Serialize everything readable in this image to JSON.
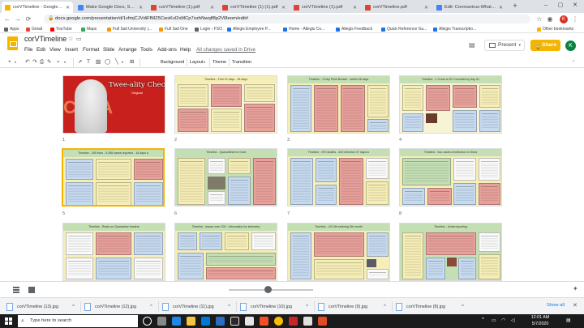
{
  "browser": {
    "tabs": [
      {
        "title": "corVTimeline - Google Sli",
        "active": true,
        "color": "#f4b400"
      },
      {
        "title": "Make Google Docs, Sheets,",
        "active": false,
        "color": "#4285f4"
      },
      {
        "title": "corVTimeline (1).pdf",
        "active": false,
        "color": "#db4437"
      },
      {
        "title": "corVTimeline (1) (1).pdf",
        "active": false,
        "color": "#db4437"
      },
      {
        "title": "corVTimeline (1).pdf",
        "active": false,
        "color": "#db4437"
      },
      {
        "title": "corVTimeline.pdf",
        "active": false,
        "color": "#db4437"
      },
      {
        "title": "Edit: Coronavirus-What do",
        "active": false,
        "color": "#4285f4"
      }
    ],
    "new_tab": "+",
    "window_controls": {
      "minimize": "–",
      "maximize": "▢",
      "close": "✕"
    },
    "url": "docs.google.com/presentation/d/1vfmjCJVdiFfMZ5CwsKvl2xMCp7ozhNwqlf8p2Vl8eom/edit#",
    "profile_initial": "K",
    "bookmarks": [
      {
        "label": "Apps",
        "color": "#5f6368"
      },
      {
        "label": "Gmail",
        "color": "#ea4335"
      },
      {
        "label": "YouTube",
        "color": "#ff0000"
      },
      {
        "label": "Maps",
        "color": "#34a853"
      },
      {
        "label": "Full Sail University |...",
        "color": "#f29900"
      },
      {
        "label": "Full Sail One",
        "color": "#f29900"
      },
      {
        "label": "Login ‹ FSO",
        "color": "#5f6368"
      },
      {
        "label": "Allegis Employee P...",
        "color": "#1a73e8"
      },
      {
        "label": "Home - Allegis Co...",
        "color": "#1a73e8"
      },
      {
        "label": "Allegis Feedback",
        "color": "#1a73e8"
      },
      {
        "label": "Quick Reference Gu...",
        "color": "#1a73e8"
      },
      {
        "label": "Allegis Transcriptio...",
        "color": "#1a73e8"
      },
      {
        "label": "Other bookmarks",
        "color": "#f4b400"
      }
    ]
  },
  "app": {
    "doc_title": "corVTimeline",
    "menus": [
      "File",
      "Edit",
      "View",
      "Insert",
      "Format",
      "Slide",
      "Arrange",
      "Tools",
      "Add-ons",
      "Help"
    ],
    "saved_status": "All changes saved in Drive",
    "present_label": "Present",
    "share_label": "Share",
    "avatar_initial": "K",
    "accent_color": "#f4b400",
    "toolbar": {
      "background": "Background",
      "layout": "Layout",
      "theme": "Theme",
      "transition": "Transition"
    }
  },
  "slides": [
    {
      "number": "1",
      "title": "Twee-ality Check",
      "subtitle": "Original"
    },
    {
      "number": "2",
      "title": "Timeline - First 22 days - 28 days"
    },
    {
      "number": "3",
      "title": "Timeline - 3 Day Point Breach - within 28 days"
    },
    {
      "number": "4",
      "title": "Timeline - 1 Cross to 51 Countries by day 51"
    },
    {
      "number": "5",
      "title": "Timeline - 300 lives - 9,356 cases reported - 16 days a"
    },
    {
      "number": "6",
      "title": "Timeline - Quarantines to Gold"
    },
    {
      "number": "7",
      "title": "Timeline - 970 deaths - 400 infection 37 days lo"
    },
    {
      "number": "8",
      "title": "Timeline - two cases of infection in China"
    },
    {
      "number": "9",
      "title": "Timeline - Rests on Quarantine leaders"
    },
    {
      "number": "10",
      "title": "Timeline - issues over 200 - Information for telemetry"
    },
    {
      "number": "11",
      "title": "Timeline - US 4th entering 3th month"
    },
    {
      "number": "12",
      "title": "Timeline - Underreporting"
    }
  ],
  "downloads": [
    {
      "name": "corVTimeline (13).jpg"
    },
    {
      "name": "corVTimeline (12).jpg"
    },
    {
      "name": "corVTimeline (11).jpg"
    },
    {
      "name": "corVTimeline (10).jpg"
    },
    {
      "name": "corVTimeline (9).jpg"
    },
    {
      "name": "corVTimeline (8).jpg"
    }
  ],
  "show_all": "Show all",
  "taskbar": {
    "search_placeholder": "Type here to search",
    "time": "12:01 AM",
    "date": "5/7/2020"
  }
}
